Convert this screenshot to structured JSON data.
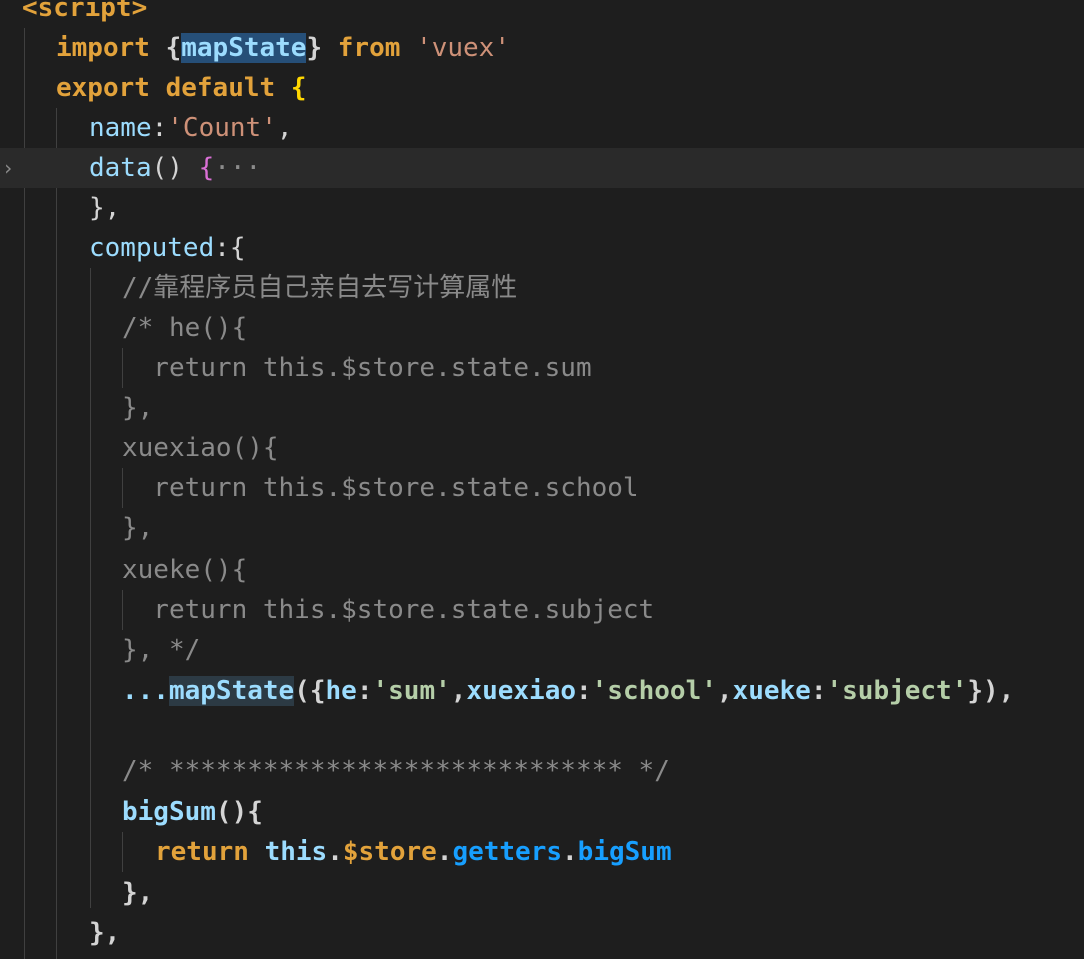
{
  "editor": {
    "language": "vue/javascript",
    "colors": {
      "background": "#1e1e1e",
      "keyword": "#e2a23b",
      "string": "#ce9178",
      "property": "#9cdcfe",
      "comment": "#8a8a8a",
      "selection": "#264f78"
    },
    "lines": {
      "l1": "<script>",
      "l2_import": "import",
      "l2_brace_open": "{",
      "l2_sel": "mapState",
      "l2_brace_close": "}",
      "l2_from": "from",
      "l2_str": "'vuex'",
      "l3_export": "export",
      "l3_default": "default",
      "l3_brace": "{",
      "l4_key": "name",
      "l4_colon": ":",
      "l4_val": "'Count'",
      "l4_comma": ",",
      "l5_fn": "data",
      "l5_paren": "()",
      "l5_brace": "{",
      "l5_fold": "···",
      "l6": "},",
      "l7_key": "computed",
      "l7_rest": ":{",
      "l8": "//靠程序员自己亲自去写计算属性",
      "l9": "/* he(){",
      "l10": "  return this.$store.state.sum",
      "l11": "},",
      "l12": "xuexiao(){",
      "l13": "  return this.$store.state.school",
      "l14": "},",
      "l15": "xueke(){",
      "l16": "  return this.$store.state.subject",
      "l17": "}, */",
      "l18_spread": "...",
      "l18_fn": "mapState",
      "l18_open": "({",
      "l18_k1": "he",
      "l18_v1": "'sum'",
      "l18_k2": "xuexiao",
      "l18_v2": "'school'",
      "l18_k3": "xueke",
      "l18_v3": "'subject'",
      "l18_close": "}),",
      "l19": "/* ***************************** */",
      "l20_fn": "bigSum",
      "l20_rest": "(){",
      "l21_return": "return",
      "l21_this": "this",
      "l21_store": "$store",
      "l21_getters": "getters",
      "l21_big": "bigSum",
      "l22": "},",
      "l23": "},"
    }
  }
}
